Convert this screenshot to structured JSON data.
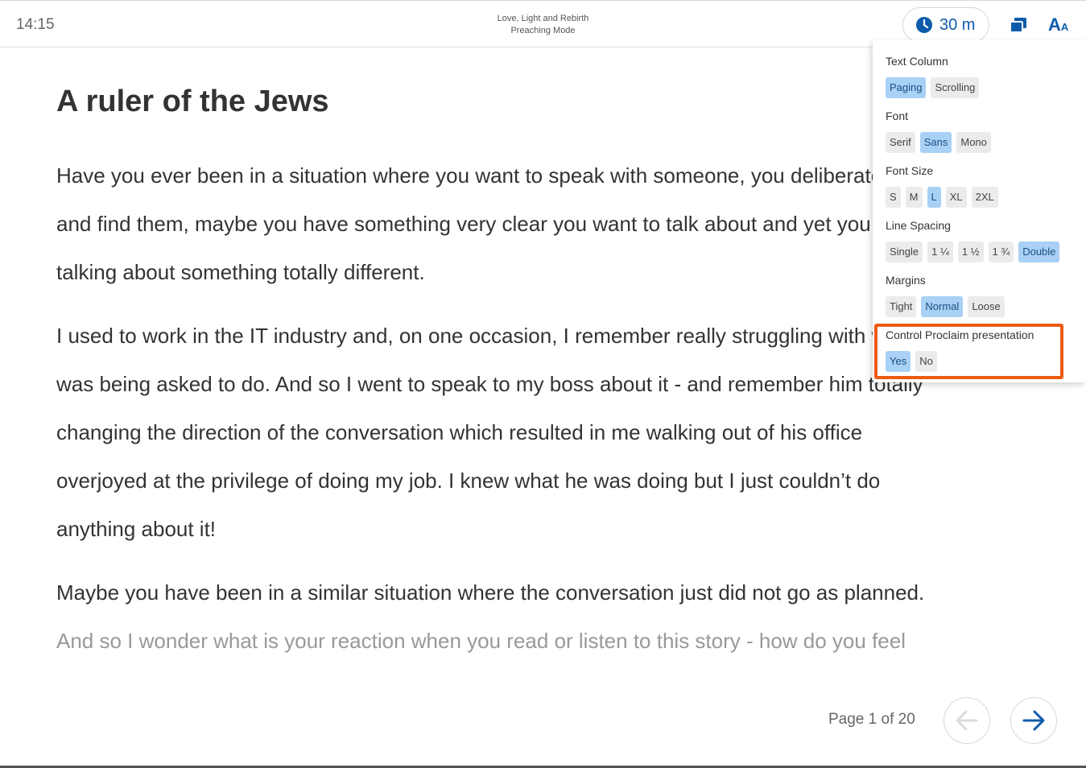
{
  "header": {
    "clock": "14:15",
    "doc_title": "Love, Light and Rebirth",
    "mode": "Preaching Mode",
    "timer_label": "30 m",
    "text_settings_label_big": "A",
    "text_settings_label_small": "A"
  },
  "content": {
    "heading": "A ruler of the Jews",
    "paragraphs": [
      {
        "lines": [
          "Have you ever been in a situation where you want to speak with someone, you deliberately go",
          "and find them, maybe you have something very clear you want to talk about and yet you end up",
          "talking about something totally different."
        ]
      },
      {
        "lines": [
          "I used to work in the IT industry and, on one occasion, I remember really struggling with what I",
          "was being asked to do. And so I went to speak to my boss about it - and remember him totally",
          "changing the direction of the conversation which resulted in me walking out of his office",
          "overjoyed at the privilege of doing my job. I knew what he was doing but I just couldn’t do",
          "anything about it!"
        ]
      },
      {
        "lines": [
          "Maybe you have been in a similar situation where the conversation just did not go as planned."
        ]
      },
      {
        "lines": [
          "And so I wonder what is your reaction when you read or listen to this story - how do you feel"
        ]
      }
    ]
  },
  "settings_panel": {
    "text_column": {
      "label": "Text Column",
      "options": [
        "Paging",
        "Scrolling"
      ],
      "selected": "Paging"
    },
    "font": {
      "label": "Font",
      "options": [
        "Serif",
        "Sans",
        "Mono"
      ],
      "selected": "Sans"
    },
    "font_size": {
      "label": "Font Size",
      "options": [
        "S",
        "M",
        "L",
        "XL",
        "2XL"
      ],
      "selected": "L"
    },
    "line_spacing": {
      "label": "Line Spacing",
      "options": [
        "Single",
        "1 ¼",
        "1 ½",
        "1 ¾",
        "Double"
      ],
      "selected": "Double"
    },
    "margins": {
      "label": "Margins",
      "options": [
        "Tight",
        "Normal",
        "Loose"
      ],
      "selected": "Normal"
    },
    "proclaim": {
      "label": "Control Proclaim presentation",
      "options": [
        "Yes",
        "No"
      ],
      "selected": "Yes"
    }
  },
  "footer": {
    "page_indicator": "Page 1 of 20"
  },
  "colors": {
    "accent": "#0d5cab",
    "selected_option": "#a9d0f5",
    "highlight_border": "#ec5b12"
  }
}
